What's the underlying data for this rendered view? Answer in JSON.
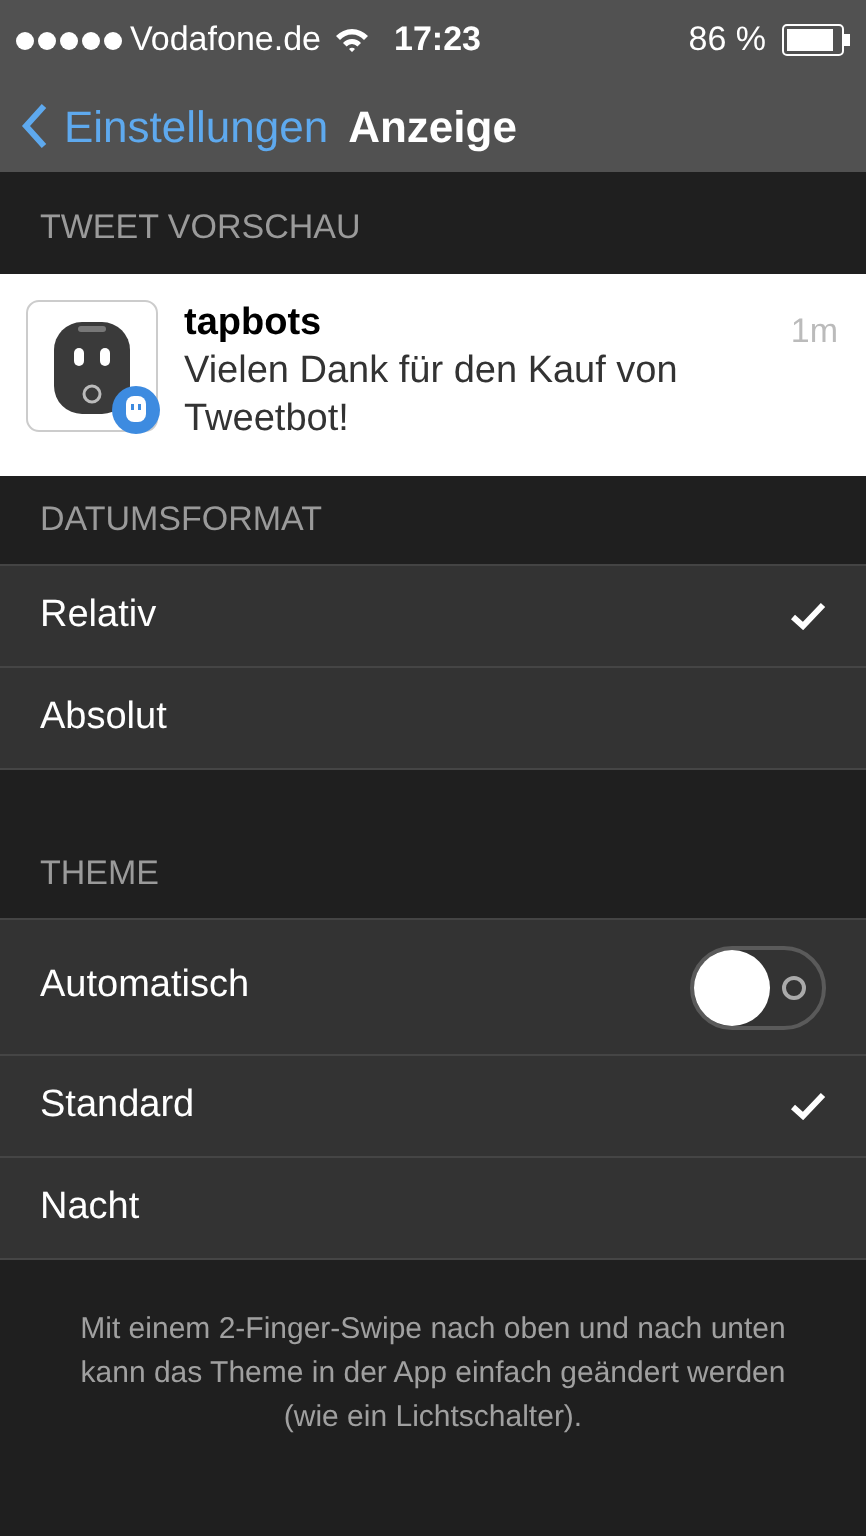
{
  "status_bar": {
    "carrier": "Vodafone.de",
    "time": "17:23",
    "battery": "86 %"
  },
  "nav": {
    "back": "Einstellungen",
    "title": "Anzeige"
  },
  "preview": {
    "header": "TWEET VORSCHAU",
    "name": "tapbots",
    "time": "1m",
    "text": "Vielen Dank für den Kauf von Tweetbot!"
  },
  "sections": [
    {
      "header": "DATUMSFORMAT",
      "rows": [
        {
          "kind": "check",
          "label": "Relativ",
          "selected": true
        },
        {
          "kind": "check",
          "label": "Absolut",
          "selected": false
        }
      ]
    },
    {
      "header": "THEME",
      "rows": [
        {
          "kind": "toggle",
          "label": "Automatisch",
          "on": false
        },
        {
          "kind": "check",
          "label": "Standard",
          "selected": true
        },
        {
          "kind": "check",
          "label": "Nacht",
          "selected": false
        }
      ]
    }
  ],
  "footer": "Mit einem 2-Finger-Swipe nach oben und nach unten kann das Theme in der App einfach geändert werden (wie ein Lichtschalter)."
}
